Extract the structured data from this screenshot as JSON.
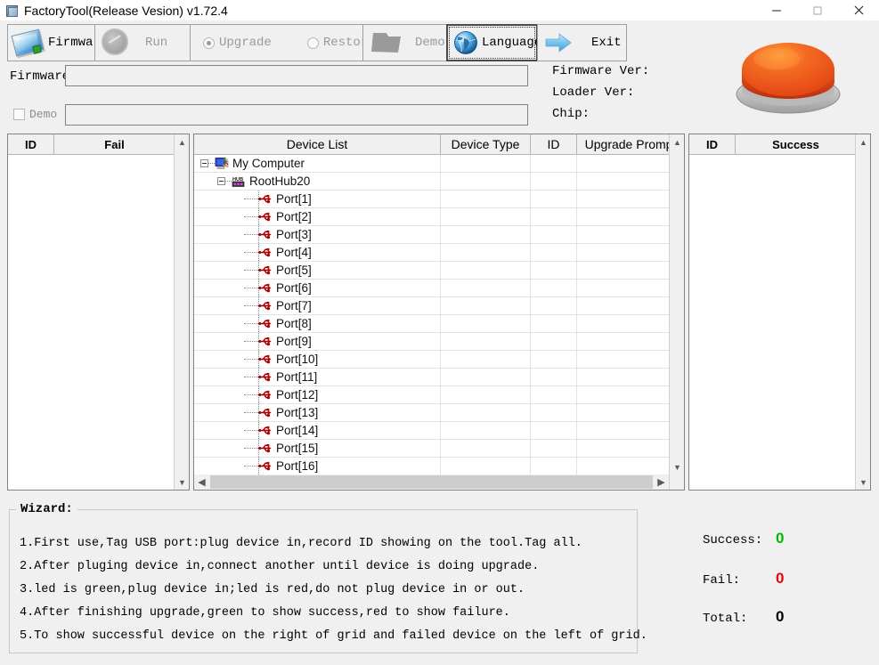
{
  "window": {
    "title": "FactoryTool(Release Vesion) v1.72.4",
    "icon": "app-icon",
    "minimize_label": "─",
    "maximize_label": "□",
    "close_label": "✕"
  },
  "toolbar": {
    "firmware_label": "Firmware",
    "run_label": "Run",
    "upgrade_label": "Upgrade",
    "restore_label": "Restore",
    "demo_label": "Demo",
    "language_label": "Language",
    "exit_label": "Exit",
    "upgrade_selected": true,
    "restore_selected": false,
    "run_enabled": false,
    "demo_enabled": false
  },
  "form": {
    "firmware_label": "Firmware",
    "firmware_value": "",
    "firmware_placeholder": "",
    "demo_checkbox_label": "Demo",
    "demo_checked": false,
    "demo_value": "",
    "demo_placeholder": ""
  },
  "version_info": {
    "firmware_ver_label": "Firmware Ver:",
    "firmware_ver_value": "",
    "loader_ver_label": "Loader Ver:",
    "loader_ver_value": "",
    "chip_label": "Chip:",
    "chip_value": ""
  },
  "big_button": {
    "name": "start-push-button",
    "color": "#ee4a1c",
    "base_color": "#c8c8c8"
  },
  "fail_grid": {
    "columns": [
      "ID",
      "Fail"
    ],
    "rows": []
  },
  "success_grid": {
    "columns": [
      "ID",
      "Success"
    ],
    "rows": []
  },
  "device_grid": {
    "columns": [
      "Device List",
      "Device Type",
      "ID",
      "Upgrade Prompt"
    ],
    "tree": [
      {
        "label": "My Computer",
        "depth": 0,
        "icon": "computer-icon",
        "expanded": true
      },
      {
        "label": "RootHub20",
        "depth": 1,
        "icon": "hub-icon",
        "expanded": true
      },
      {
        "label": "Port[1]",
        "depth": 2,
        "icon": "usb-icon"
      },
      {
        "label": "Port[2]",
        "depth": 2,
        "icon": "usb-icon"
      },
      {
        "label": "Port[3]",
        "depth": 2,
        "icon": "usb-icon"
      },
      {
        "label": "Port[4]",
        "depth": 2,
        "icon": "usb-icon"
      },
      {
        "label": "Port[5]",
        "depth": 2,
        "icon": "usb-icon"
      },
      {
        "label": "Port[6]",
        "depth": 2,
        "icon": "usb-icon"
      },
      {
        "label": "Port[7]",
        "depth": 2,
        "icon": "usb-icon"
      },
      {
        "label": "Port[8]",
        "depth": 2,
        "icon": "usb-icon"
      },
      {
        "label": "Port[9]",
        "depth": 2,
        "icon": "usb-icon"
      },
      {
        "label": "Port[10]",
        "depth": 2,
        "icon": "usb-icon"
      },
      {
        "label": "Port[11]",
        "depth": 2,
        "icon": "usb-icon"
      },
      {
        "label": "Port[12]",
        "depth": 2,
        "icon": "usb-icon"
      },
      {
        "label": "Port[13]",
        "depth": 2,
        "icon": "usb-icon"
      },
      {
        "label": "Port[14]",
        "depth": 2,
        "icon": "usb-icon"
      },
      {
        "label": "Port[15]",
        "depth": 2,
        "icon": "usb-icon"
      },
      {
        "label": "Port[16]",
        "depth": 2,
        "icon": "usb-icon"
      }
    ]
  },
  "wizard": {
    "legend": "Wizard:",
    "lines": [
      "1.First use,Tag USB port:plug device in,record ID showing on the tool.Tag all.",
      "2.After pluging device in,connect another until device is doing upgrade.",
      "3.led is green,plug device in;led is red,do not plug device in or out.",
      "4.After finishing upgrade,green to show success,red to show failure.",
      "5.To show successful device on the right of grid and failed device on the left of grid."
    ]
  },
  "stats": {
    "success_label": "Success:",
    "success_value": "0",
    "success_color": "#00bb00",
    "fail_label": "Fail:",
    "fail_value": "0",
    "fail_color": "#ee0000",
    "total_label": "Total:",
    "total_value": "0",
    "total_color": "#000000"
  }
}
